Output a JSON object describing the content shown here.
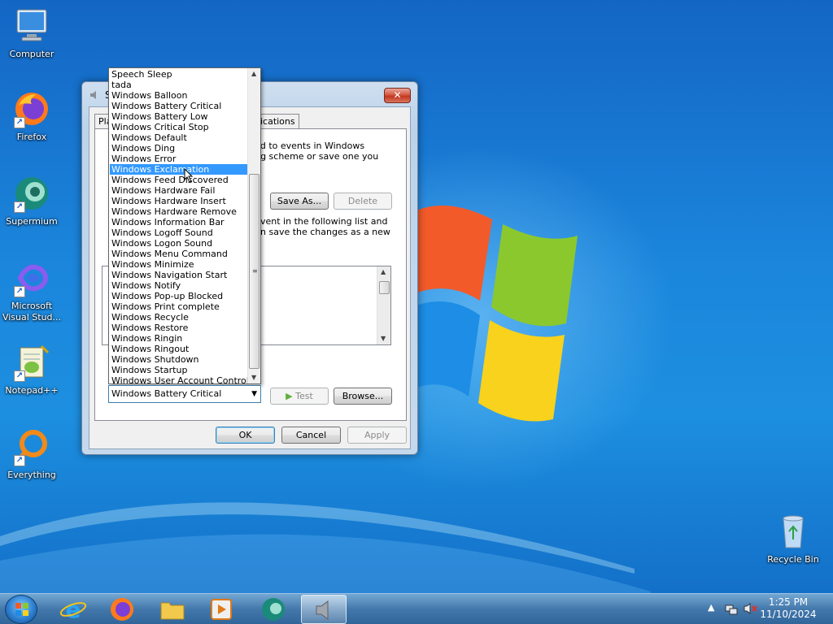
{
  "desktop": {
    "icons": [
      {
        "label": "Computer",
        "icon": "computer-icon"
      },
      {
        "label": "Firefox",
        "icon": "firefox-icon"
      },
      {
        "label": "Supermium",
        "icon": "supermium-icon"
      },
      {
        "label": "Microsoft Visual Stud...",
        "icon": "visual-studio-icon"
      },
      {
        "label": "Notepad++",
        "icon": "notepad-plus-plus-icon"
      },
      {
        "label": "Everything",
        "icon": "everything-icon"
      },
      {
        "label": "Recycle Bin",
        "icon": "recycle-bin-icon"
      }
    ]
  },
  "dialog": {
    "title": "S",
    "close_label": "✕",
    "tabs": [
      "Pla",
      "nications"
    ],
    "desc_line1": "plied to events in Windows",
    "desc_line2": "sting scheme or save one you",
    "save_as_label": "Save As...",
    "delete_label": "Delete",
    "desc2_line1": "vent in the following list and",
    "desc2_line2": "n save the changes as a new",
    "test_label": "Test",
    "browse_label": "Browse...",
    "ok_label": "OK",
    "cancel_label": "Cancel",
    "apply_label": "Apply"
  },
  "sound_dropdown": {
    "selected_value": "Windows Battery Critical",
    "highlighted_item": "Windows Exclamation",
    "items": [
      "Speech Sleep",
      "tada",
      "Windows Balloon",
      "Windows Battery Critical",
      "Windows Battery Low",
      "Windows Critical Stop",
      "Windows Default",
      "Windows Ding",
      "Windows Error",
      "Windows Exclamation",
      "Windows Feed Discovered",
      "Windows Hardware Fail",
      "Windows Hardware Insert",
      "Windows Hardware Remove",
      "Windows Information Bar",
      "Windows Logoff Sound",
      "Windows Logon Sound",
      "Windows Menu Command",
      "Windows Minimize",
      "Windows Navigation Start",
      "Windows Notify",
      "Windows Pop-up Blocked",
      "Windows Print complete",
      "Windows Recycle",
      "Windows Restore",
      "Windows Ringin",
      "Windows Ringout",
      "Windows Shutdown",
      "Windows Startup",
      "Windows User Account Control"
    ]
  },
  "taskbar": {
    "items": [
      "internet-explorer-icon",
      "firefox-icon",
      "file-explorer-icon",
      "media-player-icon",
      "supermium-icon",
      "sound-icon"
    ],
    "clock_time": "1:25 PM",
    "clock_date": "11/10/2024"
  },
  "colors": {
    "selection": "#3399ff",
    "desktop": "#1a7ad6"
  }
}
